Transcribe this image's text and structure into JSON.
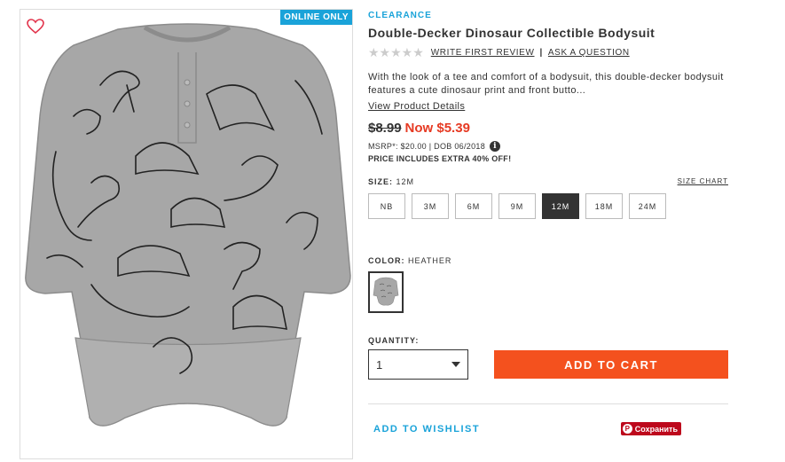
{
  "image": {
    "badge": "ONLINE ONLY",
    "heart_icon": "heart-outline-icon",
    "colors": {
      "badge": "#1aa3d9",
      "heart": "#e2334b",
      "fabric": "#a5a5a5"
    }
  },
  "product": {
    "category": "CLEARANCE",
    "title": "Double-Decker Dinosaur Collectible Bodysuit",
    "rating_stars": "★★★★★",
    "write_review": "WRITE FIRST REVIEW",
    "separator": "|",
    "ask_question": "ASK A QUESTION",
    "description": "With the look of a tee and comfort of a bodysuit, this double-decker bodysuit features a cute dinosaur print and front butto...",
    "view_details": "View Product Details"
  },
  "pricing": {
    "old_price": "$8.99",
    "now_price": "Now $5.39",
    "msrp": "MSRP*: $20.00 | DOB 06/2018",
    "info_icon": "i",
    "promo": "PRICE INCLUDES EXTRA 40% OFF!",
    "colors": {
      "now": "#e63a23"
    }
  },
  "size": {
    "label": "SIZE:",
    "selected": "12M",
    "chart_link": "SIZE CHART",
    "options": [
      "NB",
      "3M",
      "6M",
      "9M",
      "12M",
      "18M",
      "24M"
    ]
  },
  "color": {
    "label": "COLOR:",
    "selected": "HEATHER"
  },
  "quantity": {
    "label": "QUANTITY:",
    "value": "1"
  },
  "actions": {
    "add_to_cart": "ADD TO CART",
    "wishlist": "ADD TO WISHLIST",
    "pin_glyph": "P",
    "pin_label": "Сохранить",
    "colors": {
      "cart": "#f4511e",
      "pin": "#bd081c"
    }
  }
}
